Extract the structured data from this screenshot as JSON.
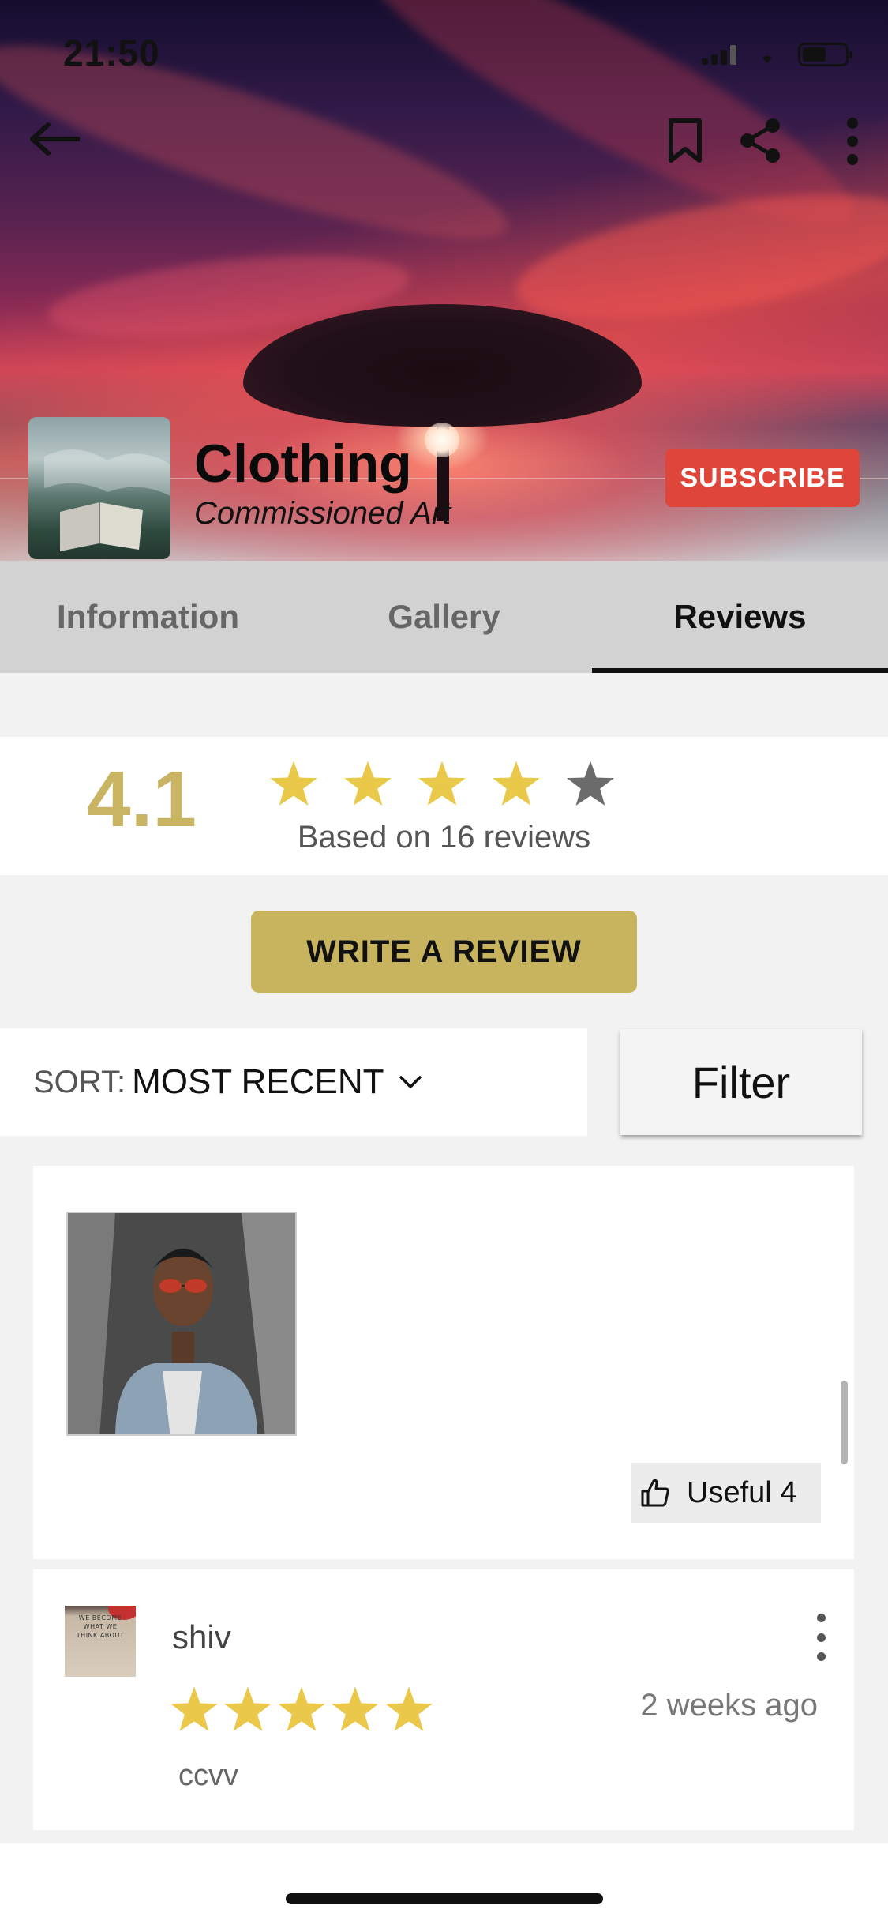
{
  "status_bar": {
    "time": "21:50"
  },
  "header": {
    "icons": [
      "arrow-left-icon",
      "bookmark-icon",
      "share-icon",
      "more-vertical-icon"
    ]
  },
  "profile": {
    "title": "Clothing",
    "subtitle": "Commissioned Art",
    "subscribe_label": "SUBSCRIBE"
  },
  "tabs": [
    {
      "label": "Information",
      "active": false
    },
    {
      "label": "Gallery",
      "active": false
    },
    {
      "label": "Reviews",
      "active": true
    }
  ],
  "rating": {
    "value": "4.1",
    "filled_stars": 4,
    "total_stars": 5,
    "based_on": "Based on 16 reviews"
  },
  "actions": {
    "write_review_label": "WRITE A REVIEW"
  },
  "sort": {
    "label": "SORT:",
    "value": "MOST RECENT"
  },
  "filter": {
    "label": "Filter"
  },
  "reviews": [
    {
      "has_photo": true,
      "useful_label": "Useful 4"
    },
    {
      "author": "shiv",
      "time": "2 weeks ago",
      "stars": 5,
      "text": "ccvv",
      "avatar_text": "WE BECOME WHAT WE THINK ABOUT"
    }
  ],
  "colors": {
    "accent_gold": "#c8b45e",
    "rating_gold": "#c8b463",
    "star_gold": "#e9c84a",
    "star_empty": "#6b6b6b",
    "subscribe_red": "#e0453a"
  }
}
